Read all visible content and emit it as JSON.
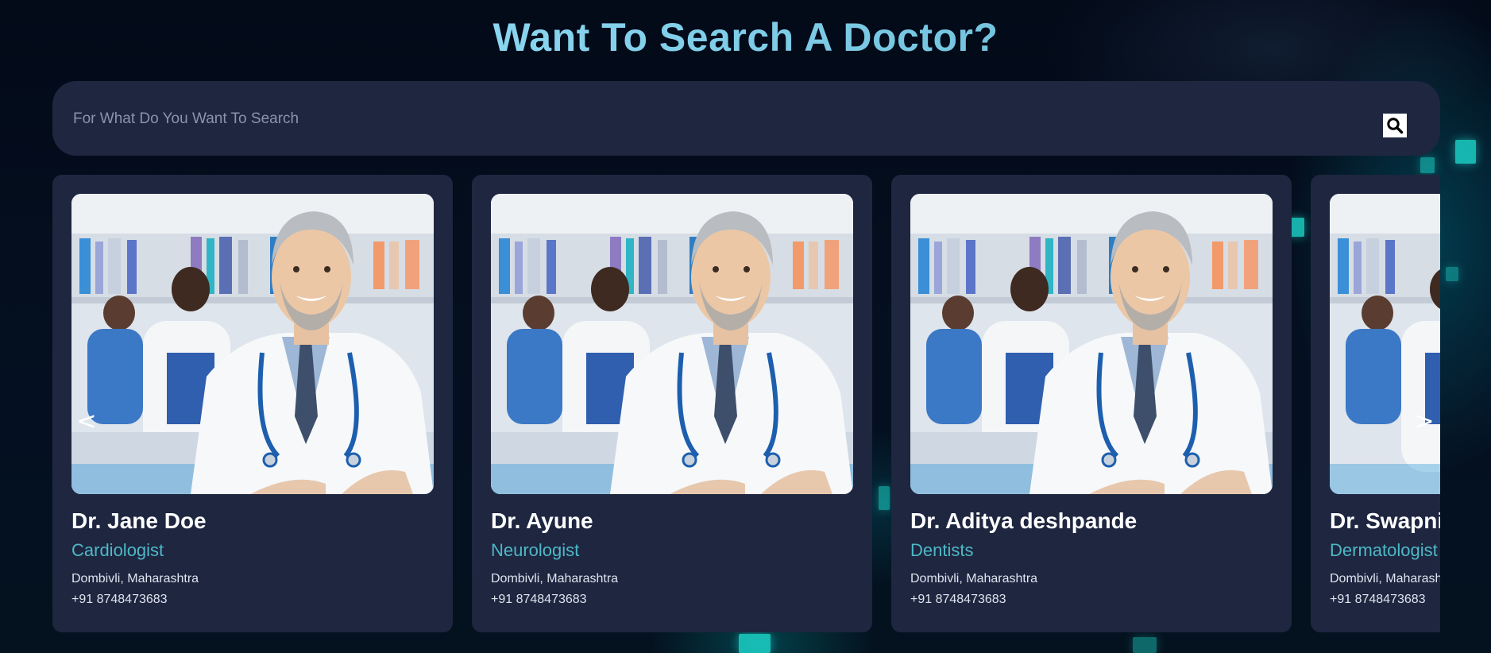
{
  "page": {
    "title": "Want To Search A Doctor?"
  },
  "search": {
    "placeholder": "For What Do You Want To Search",
    "value": "",
    "icon": "search-icon"
  },
  "carousel": {
    "prev_label": "<",
    "next_label": ">",
    "doctors": [
      {
        "name": "Dr. Jane Doe",
        "specialty": "Cardiologist",
        "location": "Dombivli, Maharashtra",
        "phone": "+91 8748473683"
      },
      {
        "name": "Dr. Ayune",
        "specialty": "Neurologist",
        "location": "Dombivli, Maharashtra",
        "phone": "+91 8748473683"
      },
      {
        "name": "Dr. Aditya deshpande",
        "specialty": "Dentists",
        "location": "Dombivli, Maharashtra",
        "phone": "+91 8748473683"
      },
      {
        "name": "Dr. Swapnil",
        "specialty": "Dermatologist",
        "location": "Dombivli, Maharashtra",
        "phone": "+91 8748473683"
      }
    ]
  },
  "colors": {
    "background": "#030b1a",
    "card": "#1e2640",
    "accent": "#4fb8c6",
    "title_gradient_start": "#9fe6ff",
    "title_gradient_end": "#5fb3cf"
  }
}
